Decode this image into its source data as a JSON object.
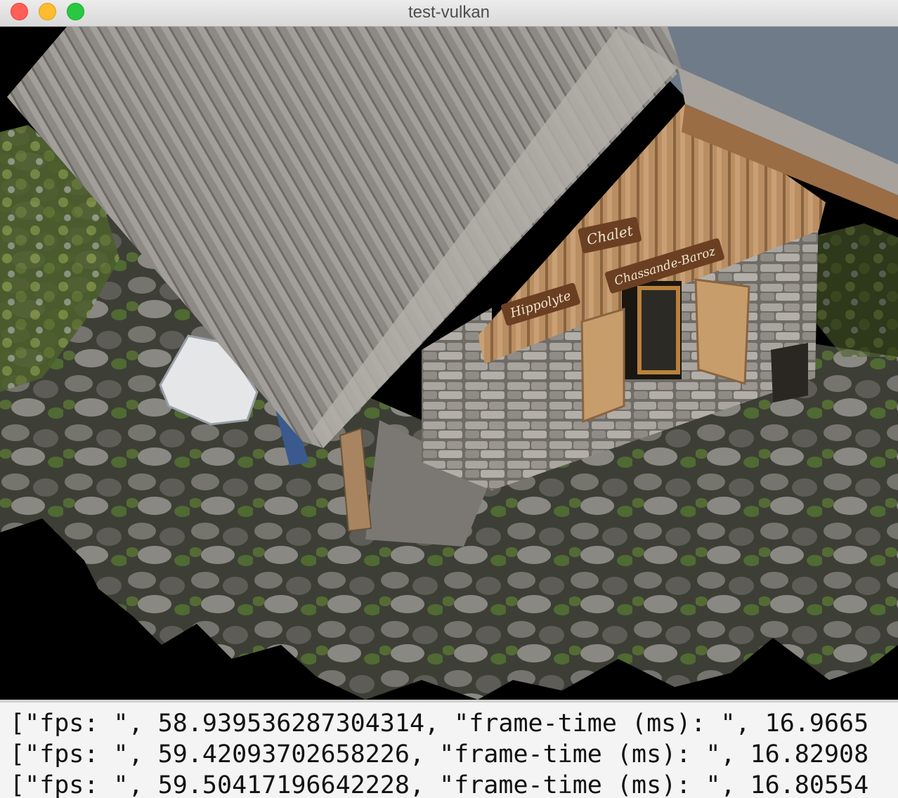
{
  "window": {
    "title": "test-vulkan",
    "controls": [
      "close",
      "minimize",
      "maximize"
    ]
  },
  "viewport": {
    "content": "3d-scene",
    "signs": {
      "sign_1": "Chalet",
      "sign_2": "Chassande-Baroz",
      "sign_3": "Hippolyte"
    }
  },
  "console": {
    "lines": [
      "[\"fps: \", 58.939536287304314, \"frame-time (ms): \", 16.9665",
      "[\"fps: \", 59.42093702658226, \"frame-time (ms): \", 16.82908",
      "[\"fps: \", 59.50417196642228, \"frame-time (ms): \", 16.80554"
    ]
  },
  "colors": {
    "close": "#ff5f57",
    "minimize": "#febc2e",
    "maximize": "#28c840",
    "viewport_bg": "#000000"
  }
}
